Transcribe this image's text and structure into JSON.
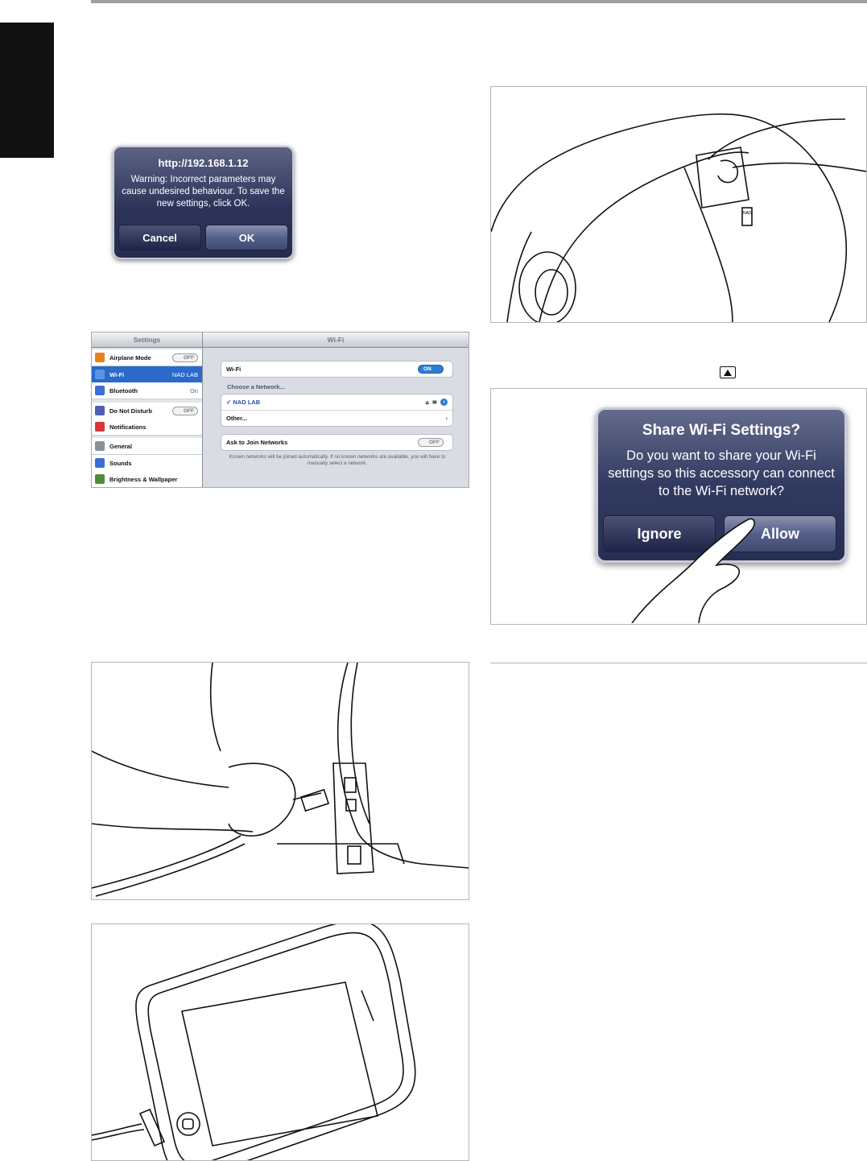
{
  "alert_save": {
    "title": "http://192.168.1.12",
    "message": "Warning: Incorrect parameters may cause undesired behaviour. To save the new settings, click OK.",
    "cancel": "Cancel",
    "ok": "OK"
  },
  "settings": {
    "left_title": "Settings",
    "right_title": "Wi-Fi",
    "items": [
      {
        "label": "Airplane Mode",
        "value": "OFF",
        "icon": "airplane-icon",
        "color": "#e8821e"
      },
      {
        "label": "Wi-Fi",
        "value": "NAD LAB",
        "icon": "wifi-icon",
        "color": "#3a79d8"
      },
      {
        "label": "Bluetooth",
        "value": "On",
        "icon": "bluetooth-icon",
        "color": "#3b6fd1"
      },
      {
        "label": "Do Not Disturb",
        "value": "OFF",
        "icon": "moon-icon",
        "color": "#4f5fb0"
      },
      {
        "label": "Notifications",
        "value": "",
        "icon": "notifications-icon",
        "color": "#d8363a"
      },
      {
        "label": "General",
        "value": "",
        "icon": "gear-icon",
        "color": "#8a8f99"
      },
      {
        "label": "Sounds",
        "value": "",
        "icon": "speaker-icon",
        "color": "#3b6fd1"
      },
      {
        "label": "Brightness & Wallpaper",
        "value": "",
        "icon": "brightness-icon",
        "color": "#4f8b3a"
      }
    ],
    "wifi_label": "Wi-Fi",
    "wifi_toggle": "ON",
    "choose_network": "Choose a Network...",
    "network_selected": "✓ NAD LAB",
    "other": "Other...",
    "ask_join": "Ask to Join Networks",
    "ask_join_toggle": "OFF",
    "note": "Known networks will be joined automatically. If no known networks are available, you will have to manually select a network."
  },
  "alert_share": {
    "title": "Share Wi-Fi Settings?",
    "message": "Do you want to share your Wi-Fi settings so this accessory can connect to the Wi-Fi network?",
    "ignore": "Ignore",
    "allow": "Allow"
  },
  "speaker_logo": "NAD"
}
